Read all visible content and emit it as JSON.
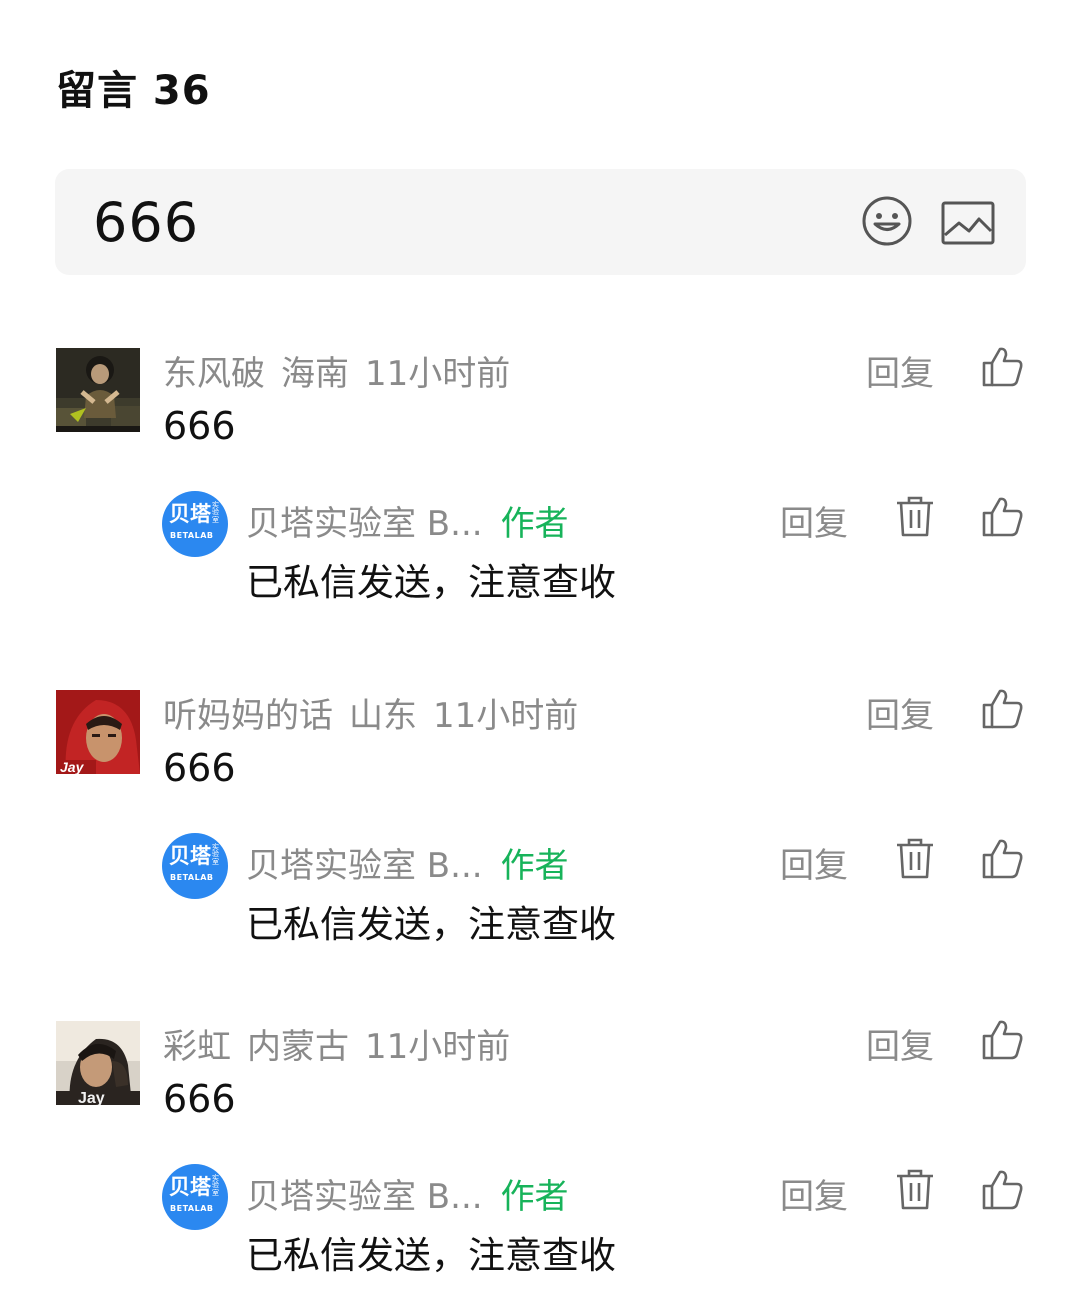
{
  "header": {
    "title": "留言 36"
  },
  "input": {
    "value": "666",
    "emoji_icon": "emoji-icon",
    "image_icon": "image-icon"
  },
  "comments": [
    {
      "name": "东风破",
      "location": "海南",
      "time": "11小时前",
      "text": "666",
      "reply_label": "回复",
      "reply": {
        "name": "贝塔实验室 B...",
        "author_tag": "作者",
        "text": "已私信发送，注意查收",
        "reply_label": "回复",
        "avatar_text": "贝塔",
        "avatar_small": "实验室",
        "avatar_sub": "BETALAB"
      }
    },
    {
      "name": "听妈妈的话",
      "location": "山东",
      "time": "11小时前",
      "text": "666",
      "reply_label": "回复",
      "reply": {
        "name": "贝塔实验室 B...",
        "author_tag": "作者",
        "text": "已私信发送，注意查收",
        "reply_label": "回复",
        "avatar_text": "贝塔",
        "avatar_small": "实验室",
        "avatar_sub": "BETALAB"
      }
    },
    {
      "name": "彩虹",
      "location": "内蒙古",
      "time": "11小时前",
      "text": "666",
      "reply_label": "回复",
      "reply": {
        "name": "贝塔实验室 B...",
        "author_tag": "作者",
        "text": "已私信发送，注意查收",
        "reply_label": "回复",
        "avatar_text": "贝塔",
        "avatar_small": "实验室",
        "avatar_sub": "BETALAB"
      }
    }
  ],
  "avatars": {
    "c0_label": "",
    "c1_label": "Jay",
    "c2_label": "Jay"
  },
  "colors": {
    "author_green": "#17b35a",
    "brand_blue": "#2b88f0",
    "meta_gray": "#8a8a8a"
  }
}
